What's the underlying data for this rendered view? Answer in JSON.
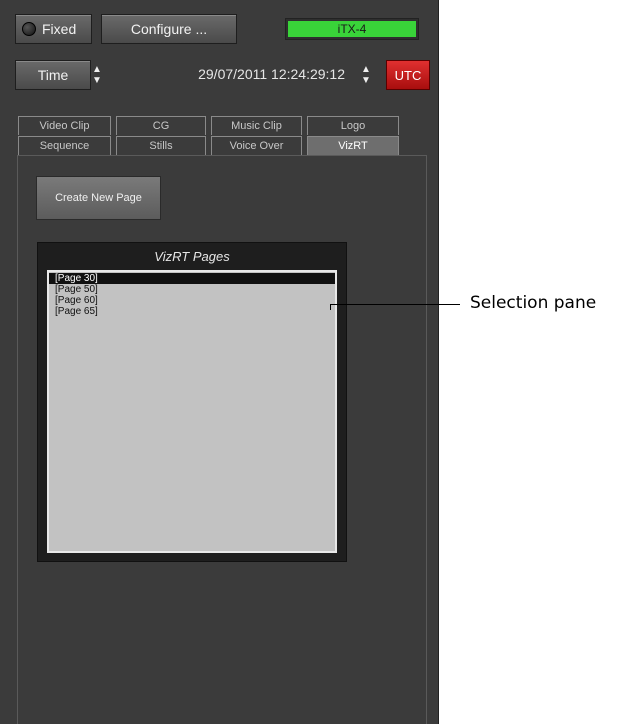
{
  "header": {
    "fixed_label": "Fixed",
    "configure_label": "Configure ...",
    "status_label": "iTX-4",
    "status_color": "#39d339"
  },
  "timebar": {
    "time_label": "Time",
    "datetime": "29/07/2011 12:24:29:12",
    "utc_label": "UTC",
    "utc_color": "#c81e1e"
  },
  "tabs": [
    {
      "label": "Video Clip",
      "active": false
    },
    {
      "label": "CG",
      "active": false
    },
    {
      "label": "Music Clip",
      "active": false
    },
    {
      "label": "Logo",
      "active": false
    },
    {
      "label": "Sequence",
      "active": false
    },
    {
      "label": "Stills",
      "active": false
    },
    {
      "label": "Voice Over",
      "active": false
    },
    {
      "label": "VizRT",
      "active": true
    }
  ],
  "main": {
    "create_new_page_label": "Create New Page",
    "pages_title": "VizRT Pages",
    "pages": [
      {
        "label": "[Page 30]",
        "selected": true
      },
      {
        "label": "[Page 50]",
        "selected": false
      },
      {
        "label": "[Page 60]",
        "selected": false
      },
      {
        "label": "[Page 65]",
        "selected": false
      }
    ]
  },
  "callout": {
    "label": "Selection pane"
  },
  "icons": {
    "led": "led-indicator-icon",
    "spinner": "up-down-spinner-icon"
  }
}
